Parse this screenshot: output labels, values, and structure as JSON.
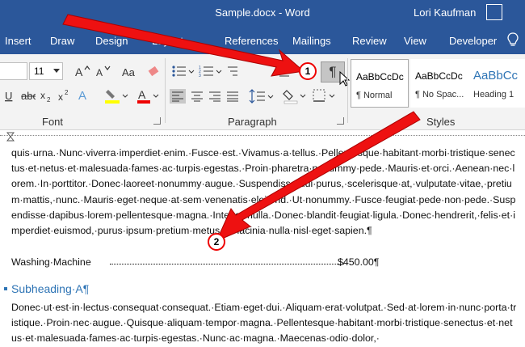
{
  "window": {
    "title": "Sample.docx - Word",
    "user": "Lori Kaufman"
  },
  "tabs": [
    "Insert",
    "Draw",
    "Design",
    "Layout",
    "References",
    "Mailings",
    "Review",
    "View",
    "Developer"
  ],
  "ribbon": {
    "font_size": "11",
    "groups": {
      "font": "Font",
      "paragraph": "Paragraph",
      "styles": "Styles"
    },
    "show_hide_symbol": "¶",
    "styles": [
      {
        "sample": "AaBbCcDc",
        "name": "¶ Normal"
      },
      {
        "sample": "AaBbCcDc",
        "name": "¶ No Spac..."
      },
      {
        "sample": "AaBbCc",
        "name": "Heading 1"
      }
    ]
  },
  "annotations": {
    "badge1": "1",
    "badge2": "2"
  },
  "document": {
    "paragraph1": "quis·urna.·Nunc·viverra·imperdiet·enim.·Fusce·est.·Vivamus·a·tellus.·Pellentesque·habitant·morbi·tristique·senectus·et·netus·et·malesuada·fames·ac·turpis·egestas.·Proin·pharetra·nonummy·pede.·Mauris·et·orci.·Aenean·nec·lorem.·In·porttitor.·Donec·laoreet·nonummy·augue.·Suspendisse·dui·purus,·scelerisque·at,·vulputate·vitae,·pretium·mattis,·nunc.·Mauris·eget·neque·at·sem·venenatis·eleifend.·Ut·nonummy.·Fusce·feugiat·pede·non·pede.·Suspendisse·dapibus·lorem·pellentesque·magna.·Integer·nulla.·Donec·blandit·feugiat·ligula.·Donec·hendrerit,·felis·et·imperdiet·euismod,·purus·ipsum·pretium·metus,·in·lacinia·nulla·nisl·eget·sapien.¶",
    "tab_item": "Washing·Machine",
    "tab_price": "$450.00¶",
    "subheading": "Subheading·A¶",
    "paragraph2": "Donec·ut·est·in·lectus·consequat·consequat.·Etiam·eget·dui.·Aliquam·erat·volutpat.·Sed·at·lorem·in·nunc·porta·tristique.·Proin·nec·augue.·Quisque·aliquam·tempor·magna.·Pellentesque·habitant·morbi·tristique·senectus·et·netus·et·malesuada·fames·ac·turpis·egestas.·Nunc·ac·magna.·Maecenas·odio·dolor,·"
  },
  "colors": {
    "accent": "#2b579a",
    "heading": "#2e74b5",
    "arrow": "#ee1111"
  }
}
